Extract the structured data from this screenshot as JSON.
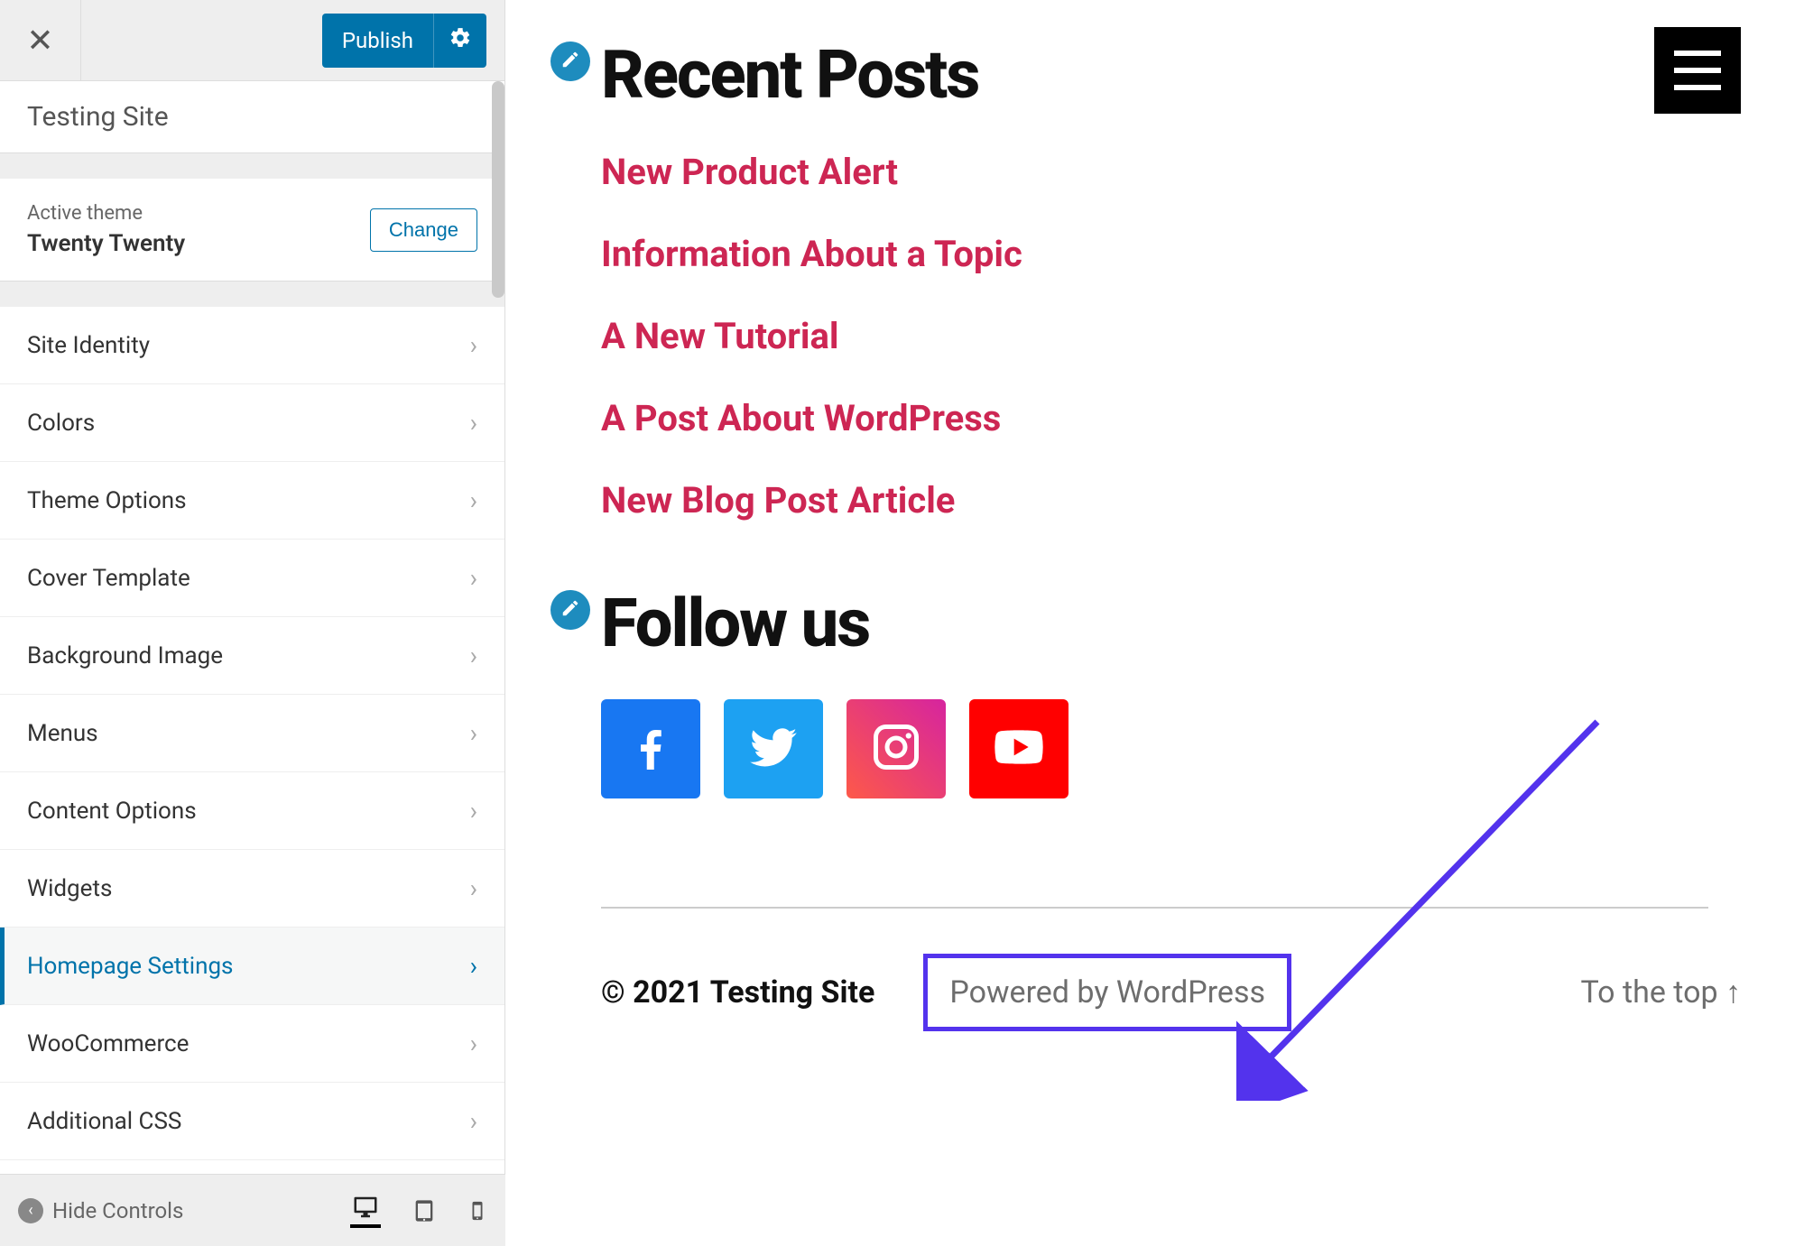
{
  "sidebar": {
    "publish_label": "Publish",
    "site_title": "Testing Site",
    "active_theme_label": "Active theme",
    "active_theme_name": "Twenty Twenty",
    "change_label": "Change",
    "hide_controls_label": "Hide Controls",
    "menu_items": [
      {
        "label": "Site Identity"
      },
      {
        "label": "Colors"
      },
      {
        "label": "Theme Options"
      },
      {
        "label": "Cover Template"
      },
      {
        "label": "Background Image"
      },
      {
        "label": "Menus"
      },
      {
        "label": "Content Options"
      },
      {
        "label": "Widgets"
      },
      {
        "label": "Homepage Settings",
        "active": true
      },
      {
        "label": "WooCommerce"
      },
      {
        "label": "Additional CSS"
      }
    ]
  },
  "preview": {
    "recent_heading": "Recent Posts",
    "recent_posts": [
      "New Product Alert",
      "Information About a Topic",
      "A New Tutorial",
      "A Post About WordPress",
      "New Blog Post Article"
    ],
    "follow_heading": "Follow us",
    "social": [
      "facebook",
      "twitter",
      "instagram",
      "youtube"
    ],
    "footer_copyright": "© 2021 Testing Site",
    "footer_powered": "Powered by WordPress",
    "to_top_label": "To the top ↑"
  }
}
